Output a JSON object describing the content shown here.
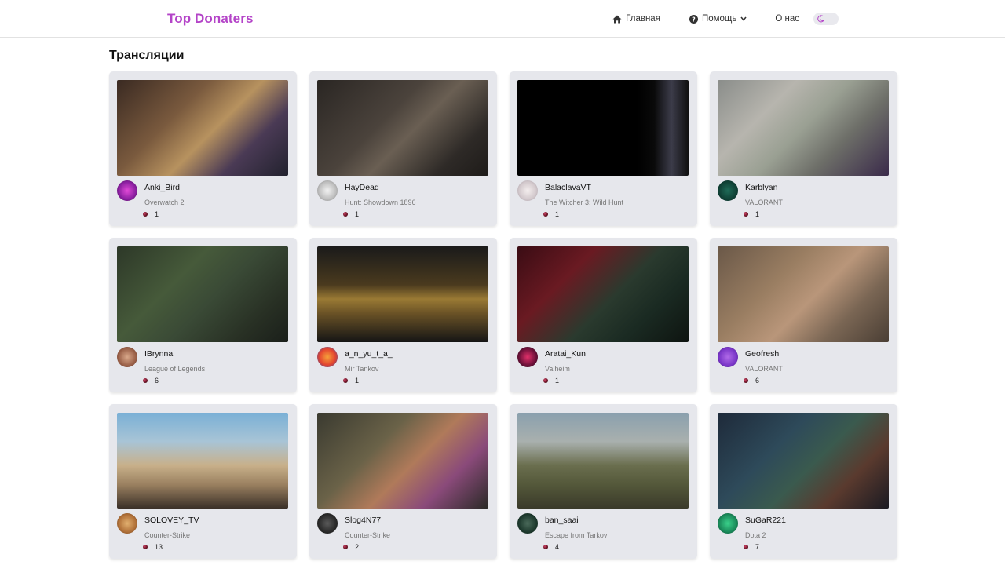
{
  "brand": "Top Donaters",
  "nav": {
    "home": "Главная",
    "help": "Помощь",
    "about": "О нас"
  },
  "colors": {
    "brand": "#b444c8",
    "card_bg": "#e6e7ec"
  },
  "section_title": "Трансляции",
  "streams": [
    {
      "name": "Anki_Bird",
      "game": "Overwatch 2",
      "donors": "1",
      "thumb": "linear-gradient(135deg,#3a2a22 0%,#7a5a3e 35%,#b7925f 55%,#4a3a55 75%,#22222e 100%)",
      "avatar": "radial-gradient(circle,#e24ad8 0%,#8a1fa0 60%,#3a0b45 100%)"
    },
    {
      "name": "HayDead",
      "game": "Hunt: Showdown 1896",
      "donors": "1",
      "thumb": "linear-gradient(135deg,#2a2623 0%,#4b433c 40%,#6a5f53 55%,#2e2a27 80%,#1e1b19 100%)",
      "avatar": "radial-gradient(circle,#f2f2f2 0%,#bdbdbd 60%,#777 100%)"
    },
    {
      "name": "BalaclavaVT",
      "game": "The Witcher 3: Wild Hunt",
      "donors": "1",
      "thumb": "linear-gradient(90deg,#000 0%,#000 70%,#0a0a0a 80%,#3c3c4a 90%,#101010 100%)",
      "avatar": "radial-gradient(circle,#f4eeee 0%,#d2c8cc 60%,#9a9098 100%)"
    },
    {
      "name": "Karblyan",
      "game": "VALORANT",
      "donors": "1",
      "thumb": "linear-gradient(135deg,#8a8d8a 0%,#b7b5ae 30%,#9aa093 50%,#6d6e68 70%,#3a2a4a 100%)",
      "avatar": "radial-gradient(circle,#1f6b58 0%,#0d3a30 70%,#05201b 100%)"
    },
    {
      "name": "IBrynna",
      "game": "League of Legends",
      "donors": "6",
      "thumb": "linear-gradient(135deg,#2d3828 0%,#465a3a 35%,#3a4a36 55%,#283024 80%,#1a1f1a 100%)",
      "avatar": "radial-gradient(circle,#d9a88a 0%,#9a6048 60%,#5a3024 100%)"
    },
    {
      "name": "a_n_yu_t_a_",
      "game": "Mir Tankov",
      "donors": "1",
      "thumb": "linear-gradient(180deg,#1a1a1a 0%,#4a3a1e 40%,#9a7a34 55%,#6a5226 70%,#151515 100%)",
      "avatar": "radial-gradient(circle,#f5a23a 0%,#e4452f 55%,#2a4fb0 100%)"
    },
    {
      "name": "Aratai_Kun",
      "game": "Valheim",
      "donors": "1",
      "thumb": "linear-gradient(135deg,#3a0c14 0%,#6a1a22 30%,#2a3a2e 55%,#1a2a22 75%,#0e1410 100%)",
      "avatar": "radial-gradient(circle,#e0306a 0%,#6a1038 60%,#1a0a14 100%)"
    },
    {
      "name": "Geofresh",
      "game": "VALORANT",
      "donors": "6",
      "thumb": "linear-gradient(135deg,#6a5848 0%,#9a7e62 35%,#b9967a 55%,#7a6654 75%,#4a3e34 100%)",
      "avatar": "radial-gradient(circle,#b06ae8 0%,#7a36c8 60%,#3a1670 100%)"
    },
    {
      "name": "SOLOVEY_TV",
      "game": "Counter-Strike",
      "donors": "13",
      "thumb": "linear-gradient(180deg,#7ab0d6 0%,#a8c4d6 30%,#c8b08a 55%,#9a8060 75%,#3a3028 100%)",
      "avatar": "radial-gradient(circle,#e2b070 0%,#b07038 60%,#5a3418 100%)"
    },
    {
      "name": "Slog4N77",
      "game": "Counter-Strike",
      "donors": "2",
      "thumb": "linear-gradient(135deg,#3a3a30 0%,#6a6248 35%,#b07a5a 55%,#8a4a7a 75%,#2a2a26 100%)",
      "avatar": "radial-gradient(circle,#5a5a5a 0%,#2a2a2a 60%,#0e0e0e 100%)"
    },
    {
      "name": "ban_saai",
      "game": "Escape from Tarkov",
      "donors": "4",
      "thumb": "linear-gradient(180deg,#8aa0ae 0%,#a9b0ae 30%,#6a6e4e 55%,#54583a 75%,#3a3a2a 100%)",
      "avatar": "radial-gradient(circle,#4a6a5a 0%,#1e3a2e 60%,#0a1a14 100%)"
    },
    {
      "name": "SuGaR221",
      "game": "Dota 2",
      "donors": "7",
      "thumb": "linear-gradient(135deg,#1e2a3a 0%,#2e4a5a 35%,#3a5a4e 55%,#5a3a2e 75%,#1a1a22 100%)",
      "avatar": "radial-gradient(circle,#3ad08a 0%,#1a8a5a 60%,#0a3a26 100%)"
    }
  ]
}
